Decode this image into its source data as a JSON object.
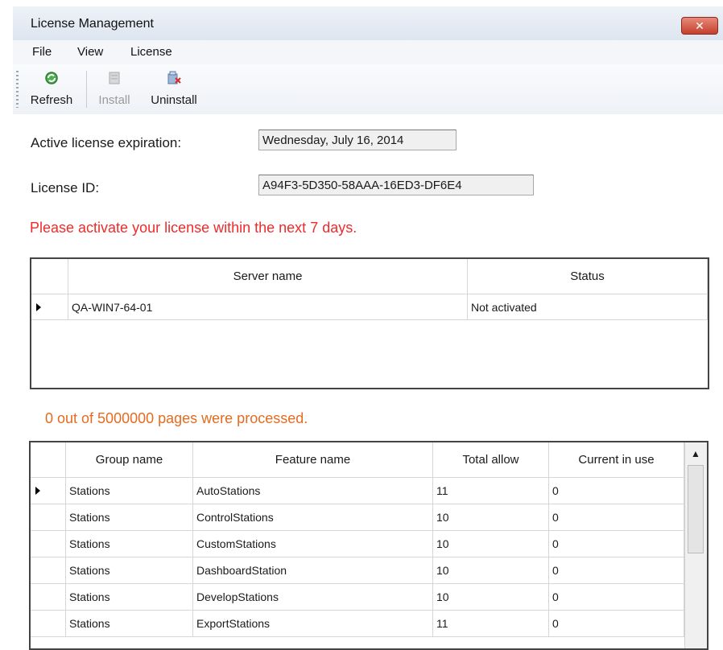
{
  "window": {
    "title": "License Management",
    "close_glyph": "✕"
  },
  "menu": {
    "items": [
      "File",
      "View",
      "License"
    ]
  },
  "toolbar": {
    "refresh_label": "Refresh",
    "install_label": "Install",
    "uninstall_label": "Uninstall"
  },
  "form": {
    "expiration_label": "Active license expiration:",
    "expiration_value": "Wednesday, July 16, 2014",
    "license_id_label": "License ID:",
    "license_id_value": "A94F3-5D350-58AAA-16ED3-DF6E4"
  },
  "warning_text": "Please activate your license within the next 7 days.",
  "servers": {
    "columns": [
      "Server name",
      "Status"
    ],
    "rows": [
      {
        "server": "QA-WIN7-64-01",
        "status": "Not activated"
      }
    ]
  },
  "pages_text": "0 out of 5000000 pages were processed.",
  "features": {
    "columns": [
      "Group name",
      "Feature name",
      "Total allow",
      "Current in use"
    ],
    "rows": [
      {
        "group": "Stations",
        "feature": "AutoStations",
        "total": "11",
        "in_use": "0"
      },
      {
        "group": "Stations",
        "feature": "ControlStations",
        "total": "10",
        "in_use": "0"
      },
      {
        "group": "Stations",
        "feature": "CustomStations",
        "total": "10",
        "in_use": "0"
      },
      {
        "group": "Stations",
        "feature": "DashboardStation",
        "total": "10",
        "in_use": "0"
      },
      {
        "group": "Stations",
        "feature": "DevelopStations",
        "total": "10",
        "in_use": "0"
      },
      {
        "group": "Stations",
        "feature": "ExportStations",
        "total": "11",
        "in_use": "0"
      }
    ]
  },
  "colors": {
    "warning": "#f02a2a",
    "pages_status": "#e56b1f"
  }
}
